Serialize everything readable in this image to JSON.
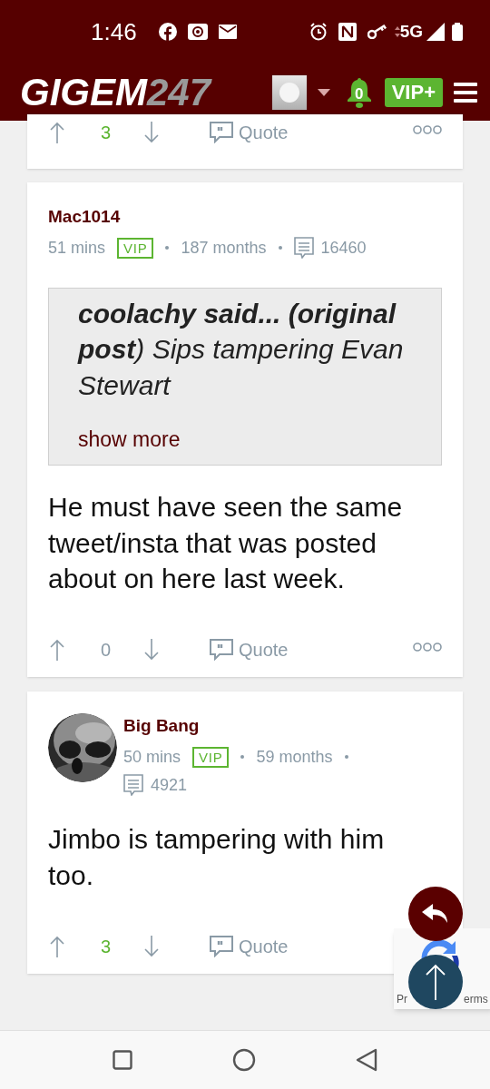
{
  "status_bar": {
    "time": "1:46",
    "network": "5G"
  },
  "header": {
    "logo_main": "GIGEM",
    "logo_suffix": "247",
    "notifications": "0",
    "vip_button": "VIP+"
  },
  "posts": [
    {
      "kind": "partial",
      "votes": "3",
      "quote_label": "Quote"
    },
    {
      "kind": "full",
      "author": "Mac1014",
      "avatar": false,
      "time": "51 mins",
      "badge": "VIP",
      "tenure": "187 months",
      "post_count": "16460",
      "quote": {
        "text": "**coolachy said... (original post**) Sips tampering Evan Stewart",
        "show_more": "show more"
      },
      "body": "He must have seen the same tweet/insta that was posted about on here last week.",
      "votes": "0",
      "quote_label": "Quote"
    },
    {
      "kind": "full",
      "author": "Big Bang",
      "avatar": true,
      "time": "50 mins",
      "badge": "VIP",
      "tenure": "59 months",
      "post_count": "4921",
      "body": "Jimbo is tampering with him too.",
      "votes": "3",
      "quote_label": "Quote"
    }
  ],
  "recaptcha": {
    "left_text": "Pr",
    "right_text": "erms"
  }
}
